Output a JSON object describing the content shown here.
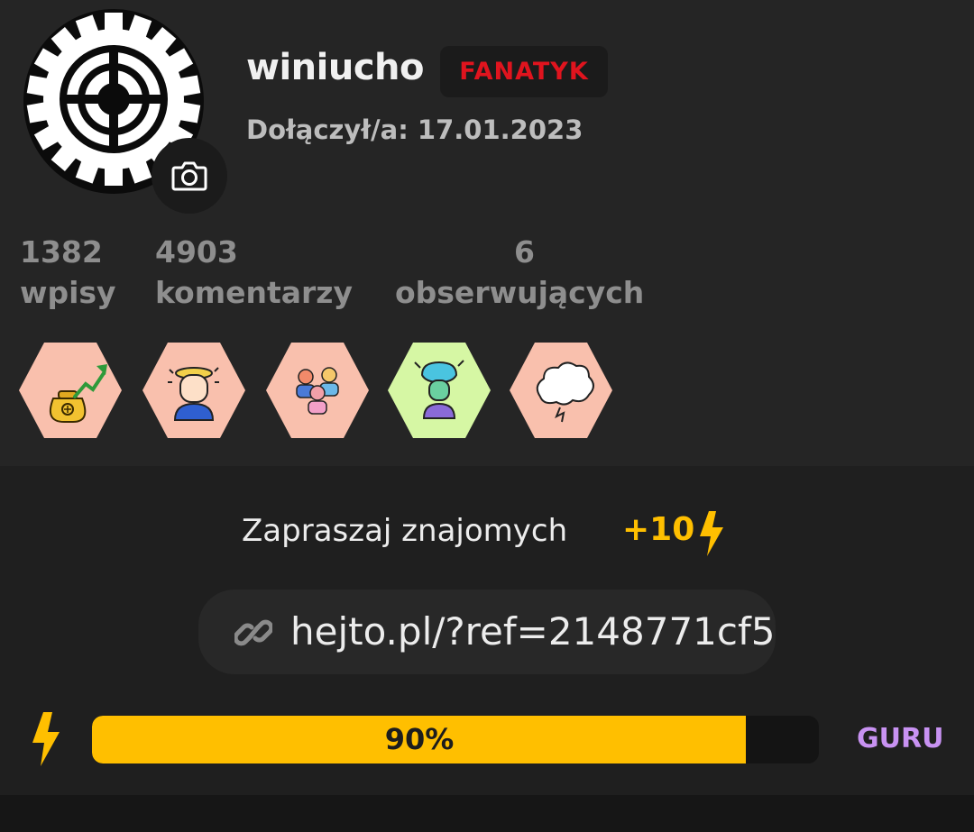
{
  "profile": {
    "username": "winiucho",
    "rank": "FANATYK",
    "joined": "Dołączył/a: 17.01.2023",
    "stats": [
      {
        "value": "1382",
        "label": "wpisy"
      },
      {
        "value": "4903",
        "label": "komentarzy"
      },
      {
        "value": "6",
        "label": "obserwujących"
      }
    ],
    "badges": [
      {
        "icon": "money-growth-badge-icon",
        "color": "#f9c0ad"
      },
      {
        "icon": "mind-blown-badge-icon",
        "color": "#f9c0ad"
      },
      {
        "icon": "group-people-badge-icon",
        "color": "#f9c0ad"
      },
      {
        "icon": "thinking-head-badge-icon",
        "color": "#d6f7a4"
      },
      {
        "icon": "explosion-cloud-badge-icon",
        "color": "#f9c0ad"
      }
    ]
  },
  "invite": {
    "title": "Zapraszaj znajomych",
    "bonus": "+10",
    "ref_link": "hejto.pl/?ref=2148771cf5"
  },
  "progress": {
    "value": 0.9,
    "label": "90%",
    "level": "GURU"
  },
  "colors": {
    "accent": "#ffbf00",
    "rank": "#e0141e",
    "level": "#c892f2",
    "background": "#252525"
  }
}
